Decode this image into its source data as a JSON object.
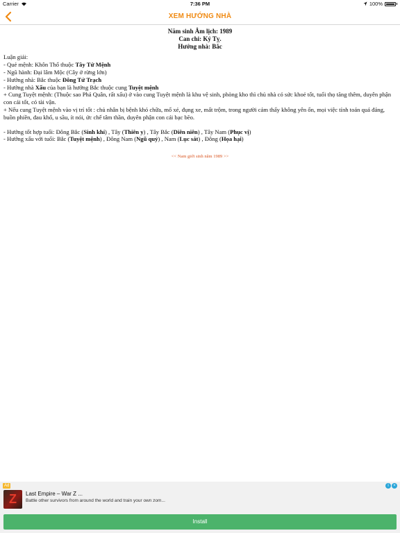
{
  "status_bar": {
    "carrier": "Carrier",
    "time": "7:36 PM",
    "battery": "100%"
  },
  "nav": {
    "title": "XEM HƯỚNG NHÀ"
  },
  "header": {
    "line1": "Năm sinh Âm lịch: 1989",
    "line2": "Can chi: Kỷ Tỵ.",
    "line3": "Hướng nhà: Bắc"
  },
  "analysis": {
    "heading": "Luận giải:",
    "que_menh": {
      "prefix": "- Quẻ mệnh: Khôn Thổ thuộc ",
      "bold": "Tây Tứ Mệnh"
    },
    "ngu_hanh": "- Ngũ hành: Đại lâm Mộc (Cây ở rừng lớn)",
    "huong_nha": {
      "prefix": "- Hướng nhà: Bắc thuộc ",
      "bold": "Đông Tứ Trạch"
    },
    "xau": {
      "prefix": "- Hướng nhà ",
      "bold1": "Xấu",
      "middle": " của bạn là hướng Bắc thuộc cung ",
      "bold2": "Tuyệt mệnh"
    },
    "cung_tuyet_menh": "+ Cung Tuyệt mệnh: (Thuộc sao Phá Quân, rất xấu) ở vào cung Tuyệt mệnh là khu vệ sinh, phòng kho thì chủ nhà có sức khoẻ tốt, tuổi thọ tăng thêm, duyên phận con cái tốt, có tài vận.",
    "neu_cung": "+ Nếu cung Tuyệt mệnh vào vị trí tốt : chủ nhân bị bệnh khó chữa, mổ xẻ, đụng xe, mất trộm, trong người cảm thấy không yên ổn, mọi việc tính toán quá đáng, buồn phiền, đau khổ, u sầu, ít nói, ức chế tâm thần, duyên phận con cái bạc bẽo."
  },
  "good_directions": {
    "prefix": "- Hướng tốt hợp tuổi: ",
    "items": [
      {
        "dir": "Đông Bắc",
        "name": "Sinh khí"
      },
      {
        "dir": "Tây",
        "name": "Thiên y"
      },
      {
        "dir": "Tây Bắc",
        "name": "Diên niên"
      },
      {
        "dir": "Tây Nam",
        "name": "Phục vị"
      }
    ]
  },
  "bad_directions": {
    "prefix": "- Hướng xấu với tuổi: ",
    "items": [
      {
        "dir": "Bắc",
        "name": "Tuyệt mệnh"
      },
      {
        "dir": "Đông Nam",
        "name": "Ngũ quỷ"
      },
      {
        "dir": "Nam",
        "name": "Lục sát"
      },
      {
        "dir": "Đông",
        "name": "Họa hại"
      }
    ]
  },
  "bottom_link": "<< Nam giới sinh năm 1989 >>",
  "ad": {
    "badge": "Ad",
    "title": "Last Empire – War Z ...",
    "description": "Battle other survivors from around the world and train your own zom...",
    "install_label": "Install",
    "thumb_letter": "Z"
  },
  "colors": {
    "accent": "#f08a12",
    "link": "#d9531e",
    "install": "#4cb36b"
  }
}
